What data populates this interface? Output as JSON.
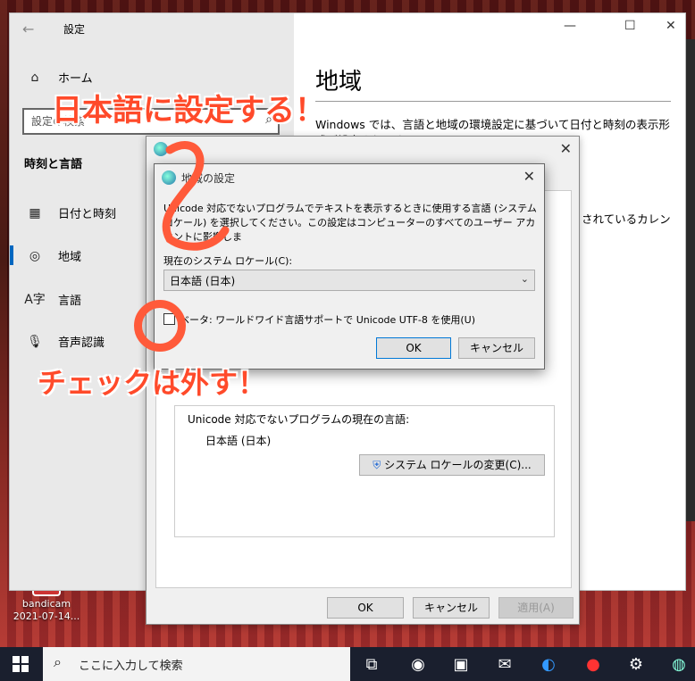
{
  "desktop": {
    "icon_label_1": "bandicam",
    "icon_label_2": "2021-07-14..."
  },
  "settings": {
    "title": "設定",
    "home": "ホーム",
    "search_placeholder": "設定の検索",
    "section": "時刻と言語",
    "nav": [
      "日付と時刻",
      "地域",
      "言語",
      "音声認識"
    ],
    "page_title": "地域",
    "page_text": "Windows では、言語と地域の環境設定に基づいて日付と時刻の表示形式が設定されます",
    "page_text2": "されているカレン"
  },
  "region_dialog": {
    "title": "地域",
    "unicode_heading": "Unicode 対応でないプログラムの現在の言語:",
    "unicode_value": "日本語 (日本)",
    "change_locale_button": "システム ロケールの変更(C)...",
    "ok": "OK",
    "cancel": "キャンセル",
    "apply": "適用(A)"
  },
  "locale_dialog": {
    "title": "地域の設定",
    "description": "Unicode 対応でないプログラムでテキストを表示するときに使用する言語 (システム ロケール) を選択してください。この設定はコンピューターのすべてのユーザー アカウントに影響しま",
    "current_label": "現在のシステム ロケール(C):",
    "current_value": "日本語 (日本)",
    "beta_label": "ベータ: ワールドワイド言語サポートで Unicode UTF-8 を使用(U)",
    "beta_checked": false,
    "ok": "OK",
    "cancel": "キャンセル"
  },
  "annotations": {
    "top": "日本語に設定する！",
    "bottom": "チェックは外す！",
    "color": "#ff4a2a"
  },
  "taskbar": {
    "search_placeholder": "ここに入力して検索"
  }
}
